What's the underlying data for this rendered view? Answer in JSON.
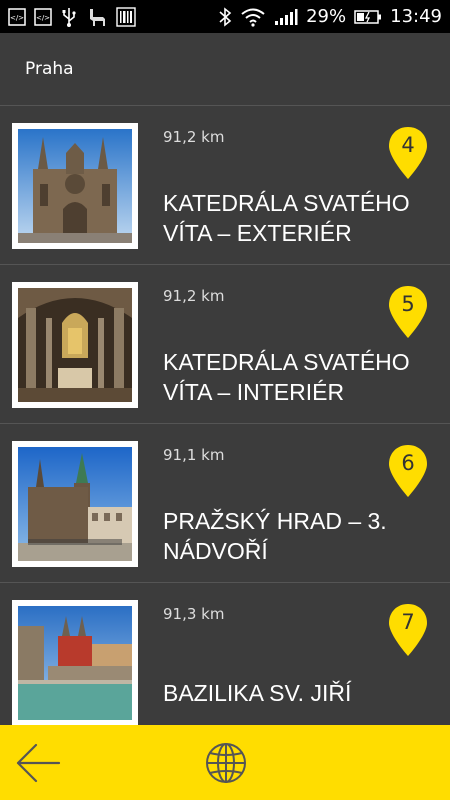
{
  "status_bar": {
    "battery": "29%",
    "time": "13:49",
    "icons": [
      "code-icon",
      "code-icon",
      "usb-icon",
      "llama-icon",
      "barcode-icon",
      "bluetooth-icon",
      "wifi-icon",
      "signal-icon",
      "battery-icon"
    ]
  },
  "header": {
    "title": "Praha"
  },
  "places": [
    {
      "distance": "91,2 km",
      "number": "4",
      "title": "KATEDRÁLA SVATÉHO VÍTA – EXTERIÉR"
    },
    {
      "distance": "91,2 km",
      "number": "5",
      "title": "KATEDRÁLA SVATÉHO VÍTA – INTERIÉR"
    },
    {
      "distance": "91,1 km",
      "number": "6",
      "title": "PRAŽSKÝ HRAD – 3. NÁDVOŘÍ"
    },
    {
      "distance": "91,3 km",
      "number": "7",
      "title": "BAZILIKA SV. JIŘÍ"
    }
  ],
  "bottom_bar": {
    "icons": [
      "back-arrow-icon",
      "globe-icon"
    ],
    "color": "#ffdd00"
  },
  "colors": {
    "background": "#3c3c3c",
    "pin": "#ffdd00",
    "accent": "#ffdd00"
  }
}
